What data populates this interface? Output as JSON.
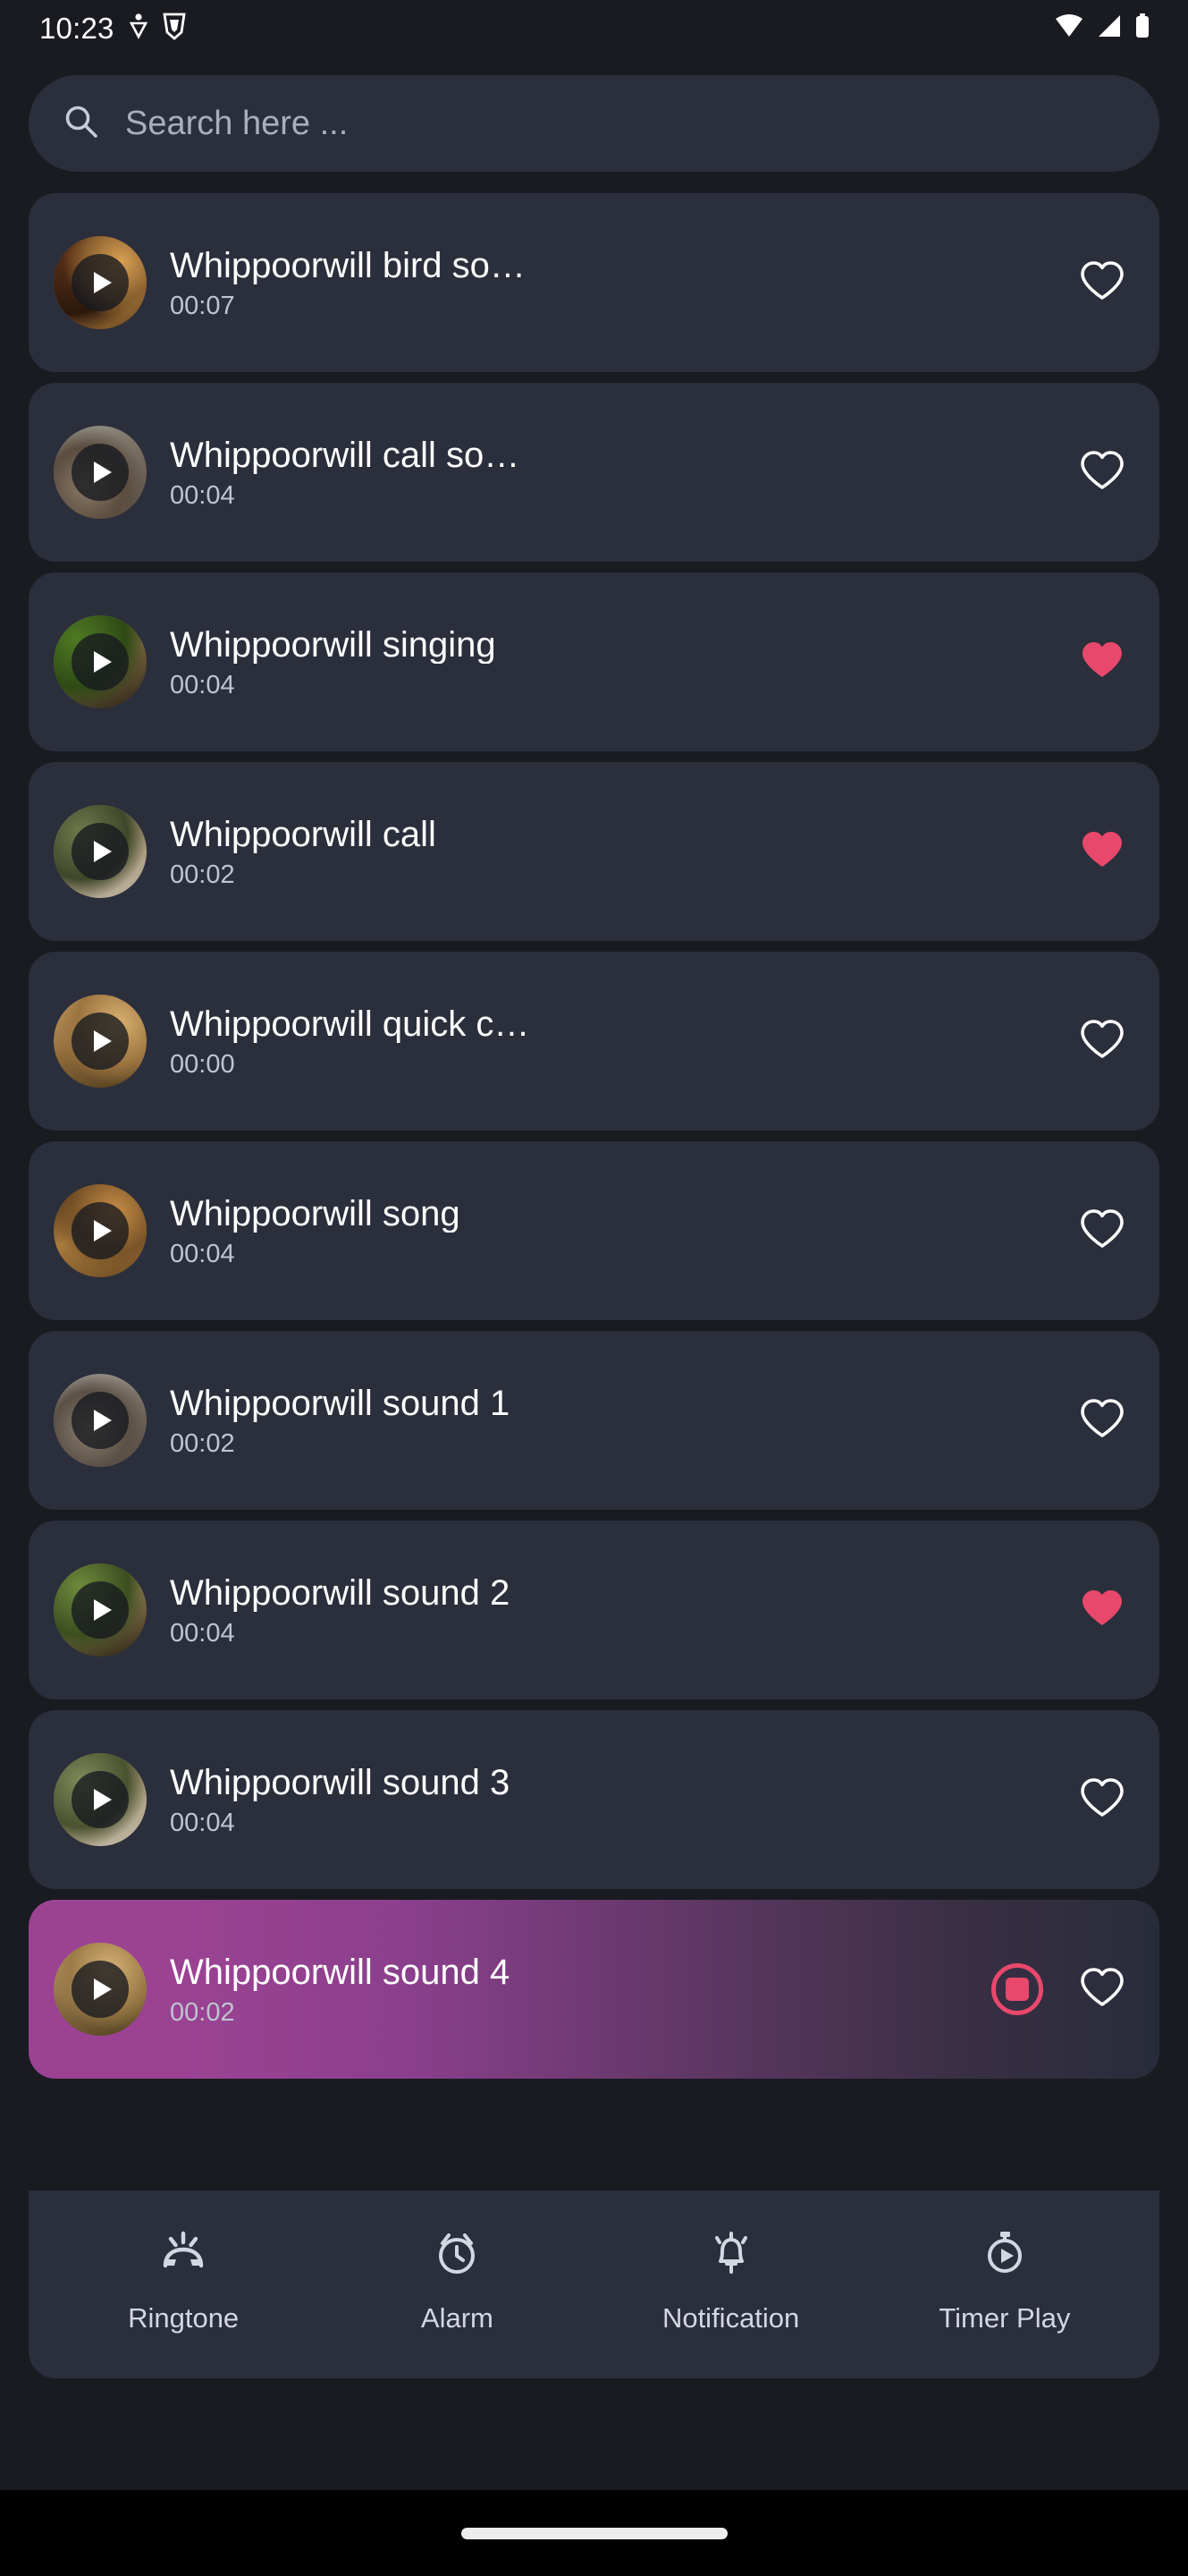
{
  "status_bar": {
    "time": "10:23",
    "left_icons": [
      "downloads-icon",
      "shield-icon"
    ],
    "right_icons": [
      "wifi-icon",
      "cellular-signal-icon",
      "battery-icon"
    ]
  },
  "search": {
    "placeholder": "Search here ...",
    "value": "",
    "icon": "search-icon"
  },
  "colors": {
    "page_background": "#191B21",
    "card_background": "#2B2E3B",
    "favorite_active": "#E8486B",
    "playing_gradient_start": "#9B4293",
    "playing_gradient_end": "#282C3A",
    "text_primary": "#FFFFFF",
    "text_secondary": "#BFC4D0"
  },
  "sounds": [
    {
      "title": "Whippoorwill bird so…",
      "duration": "00:07",
      "favorite": false,
      "playing": false,
      "thumb": "bird-thumb-1"
    },
    {
      "title": "Whippoorwill call so…",
      "duration": "00:04",
      "favorite": false,
      "playing": false,
      "thumb": "bird-thumb-2"
    },
    {
      "title": "Whippoorwill singing",
      "duration": "00:04",
      "favorite": true,
      "playing": false,
      "thumb": "bird-thumb-3"
    },
    {
      "title": "Whippoorwill call",
      "duration": "00:02",
      "favorite": true,
      "playing": false,
      "thumb": "bird-thumb-4"
    },
    {
      "title": "Whippoorwill quick c…",
      "duration": "00:00",
      "favorite": false,
      "playing": false,
      "thumb": "bird-thumb-5"
    },
    {
      "title": "Whippoorwill song",
      "duration": "00:04",
      "favorite": false,
      "playing": false,
      "thumb": "bird-thumb-6"
    },
    {
      "title": "Whippoorwill sound 1",
      "duration": "00:02",
      "favorite": false,
      "playing": false,
      "thumb": "bird-thumb-7"
    },
    {
      "title": "Whippoorwill sound 2",
      "duration": "00:04",
      "favorite": true,
      "playing": false,
      "thumb": "bird-thumb-8"
    },
    {
      "title": "Whippoorwill sound 3",
      "duration": "00:04",
      "favorite": false,
      "playing": false,
      "thumb": "bird-thumb-9"
    },
    {
      "title": "Whippoorwill sound 4",
      "duration": "00:02",
      "favorite": false,
      "playing": true,
      "thumb": "bird-thumb-10"
    }
  ],
  "bottom_nav": [
    {
      "label": "Ringtone",
      "icon": "ringtone-icon"
    },
    {
      "label": "Alarm",
      "icon": "alarm-clock-icon"
    },
    {
      "label": "Notification",
      "icon": "notification-bell-icon"
    },
    {
      "label": "Timer Play",
      "icon": "timer-play-icon"
    }
  ]
}
